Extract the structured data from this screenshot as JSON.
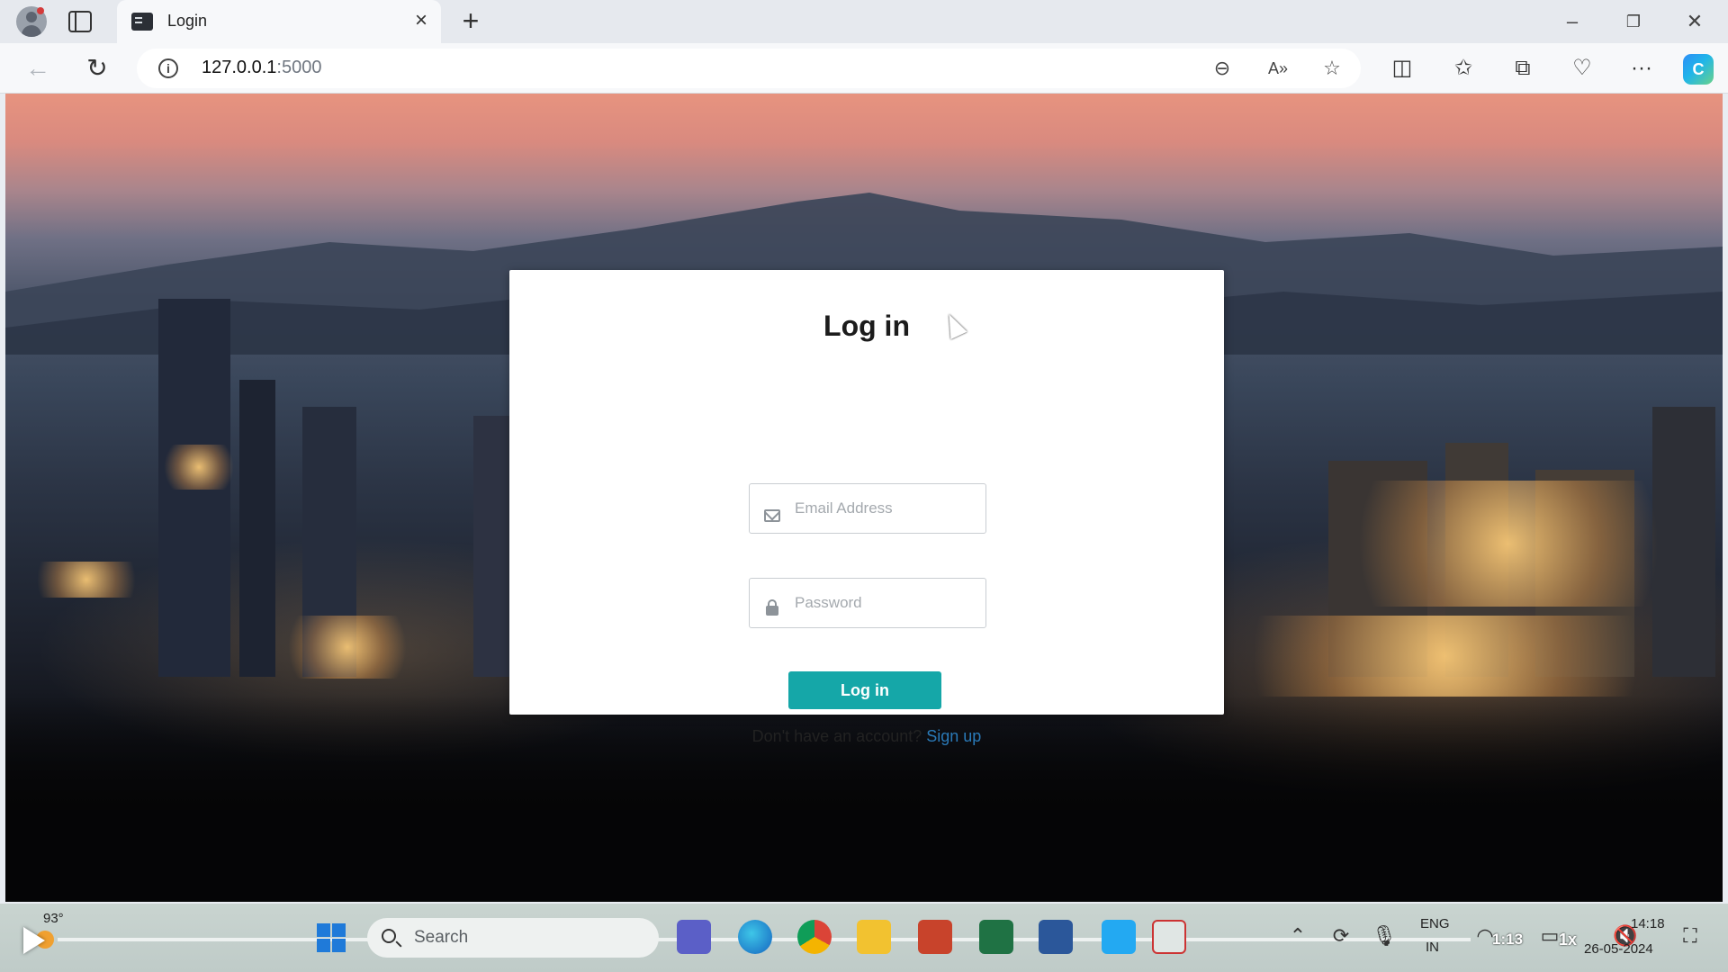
{
  "browser": {
    "tab_title": "Login",
    "url_host": "127.0.0.1",
    "url_port": ":5000"
  },
  "login": {
    "title": "Log in",
    "email_placeholder": "Email Address",
    "password_placeholder": "Password",
    "submit_label": "Log in",
    "signup_prompt": "Don't have an account?",
    "signup_link": "Sign up"
  },
  "taskbar": {
    "weather_temp": "93°",
    "search_placeholder": "Search",
    "language": "ENG",
    "region": "IN",
    "time": "14:18",
    "date": "26-05-2024"
  },
  "video": {
    "elapsed": "1:13",
    "speed": "1x",
    "progress": 0.0
  },
  "colors": {
    "accent": "#15a7a8",
    "link": "#2a7ab8"
  }
}
